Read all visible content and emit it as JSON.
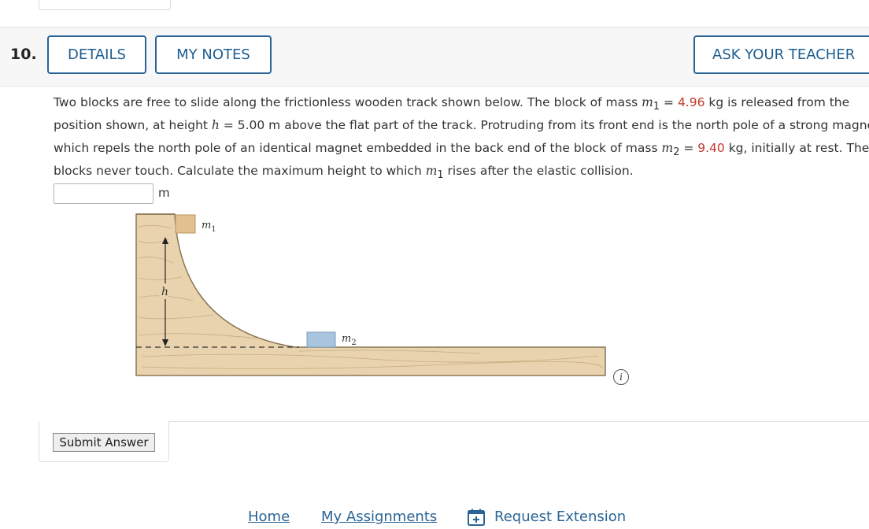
{
  "question": {
    "number": "10.",
    "details_label": "DETAILS",
    "notes_label": "MY NOTES",
    "ask_label": "ASK YOUR TEACHER",
    "text": {
      "l1_a": "Two blocks are free to slide along the frictionless wooden track shown below. The block of mass ",
      "m1_sym": "m",
      "m1_sub": "1",
      "eq": " = ",
      "m1_val": "4.96",
      "l1_b": " kg is released from the",
      "l2_a": "position shown, at height ",
      "h_sym": "h",
      "l2_b": " = 5.00 m above the flat part of the track. Protruding from its front end is the north pole of a strong magnet,",
      "l3_a": "which repels the north pole of an identical magnet embedded in the back end of the block of mass ",
      "m2_sym": "m",
      "m2_sub": "2",
      "m2_val": "9.40",
      "l3_b": " kg, initially at rest. The two",
      "l4_a": "blocks never touch. Calculate the maximum height to which ",
      "l4_b": " rises after the elastic collision."
    },
    "answer_value": "",
    "answer_unit": "m",
    "figure": {
      "m1_label": "m",
      "m1_sub": "1",
      "m2_label": "m",
      "m2_sub": "2",
      "h_label": "h",
      "wood_color": "#e8d3ae",
      "block1_color": "#e2c08f",
      "block2_color": "#a9c4de"
    },
    "info_symbol": "i",
    "submit_label": "Submit Answer"
  },
  "footer": {
    "home": "Home",
    "assignments": "My Assignments",
    "extension": "Request Extension"
  },
  "colors": {
    "link": "#2a6496",
    "value_red": "#c0392b"
  }
}
